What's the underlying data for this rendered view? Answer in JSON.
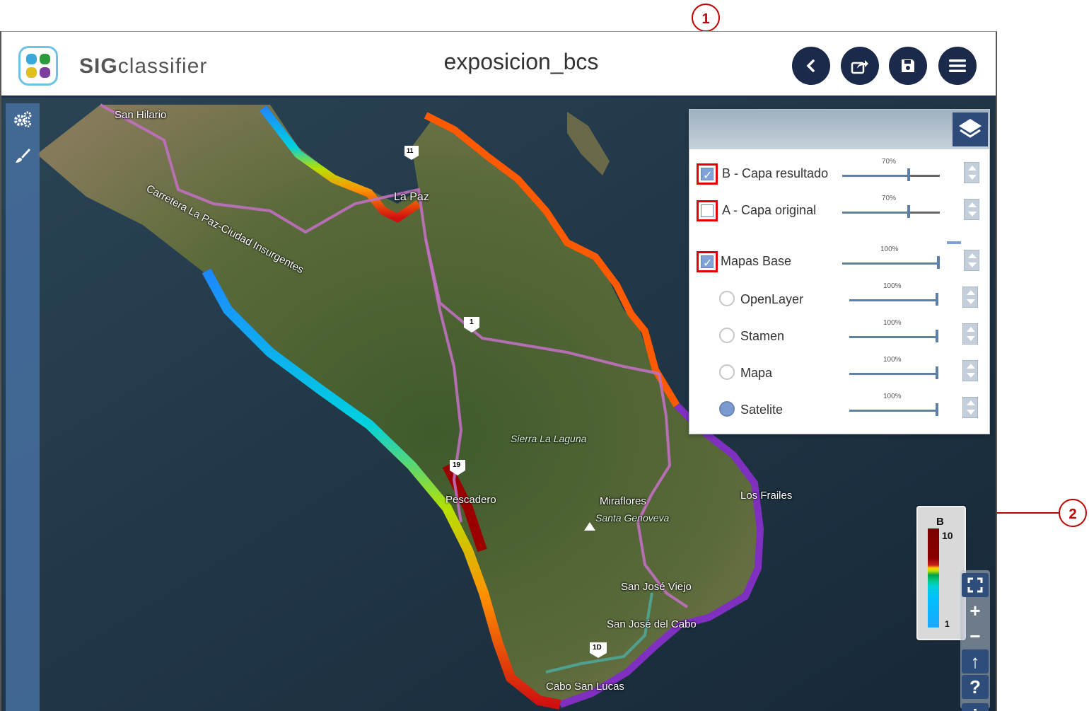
{
  "header": {
    "brand_prefix": "SIG",
    "brand_suffix": "classifier",
    "doc_title": "exposicion_bcs",
    "buttons": [
      "back-icon",
      "share-icon",
      "save-icon",
      "menu-icon"
    ]
  },
  "annotations": {
    "callout1": "1",
    "callout2": "2",
    "color": "#c00000"
  },
  "toolstrip": {
    "items": [
      "gears-icon",
      "brush-icon"
    ]
  },
  "map": {
    "labels": {
      "san_hilario": "San Hilario",
      "carretera": "Carretera La Paz-Ciudad Insurgentes",
      "la_paz": "La Paz",
      "sierra": "Sierra La Laguna",
      "pescadero": "Pescadero",
      "miraflores": "Miraflores",
      "santa_genoveva": "Santa Genoveva",
      "los_frailes": "Los Frailes",
      "san_jose_viejo": "San José Viejo",
      "san_jose_cabo": "San José del Cabo",
      "cabo_san_lucas": "Cabo San Lucas",
      "route_1": "1",
      "route_19": "19",
      "route_1d": "1D",
      "route_11": "11"
    }
  },
  "layer_panel": {
    "layers": [
      {
        "label": "B - Capa resultado",
        "opacity": "70%",
        "checked": true
      },
      {
        "label": "A - Capa original",
        "opacity": "70%",
        "checked": false
      },
      {
        "label": "Mapas Base",
        "opacity": "100%",
        "checked": true
      }
    ],
    "basemaps": [
      {
        "label": "OpenLayer",
        "opacity": "100%",
        "selected": false
      },
      {
        "label": "Stamen",
        "opacity": "100%",
        "selected": false
      },
      {
        "label": "Mapa",
        "opacity": "100%",
        "selected": false
      },
      {
        "label": "Satelite",
        "opacity": "100%",
        "selected": true
      }
    ]
  },
  "legend": {
    "title": "B",
    "max": "10",
    "min": "1"
  },
  "map_controls": {
    "fullscreen": "fullscreen-icon",
    "zoom_in": "+",
    "zoom_out": "−",
    "reset_north": "↑",
    "help": "?",
    "info": "i"
  },
  "colors": {
    "header_button": "#1b2a4a",
    "panel_accent": "#2d4a78",
    "highlight_box": "#e00000"
  }
}
